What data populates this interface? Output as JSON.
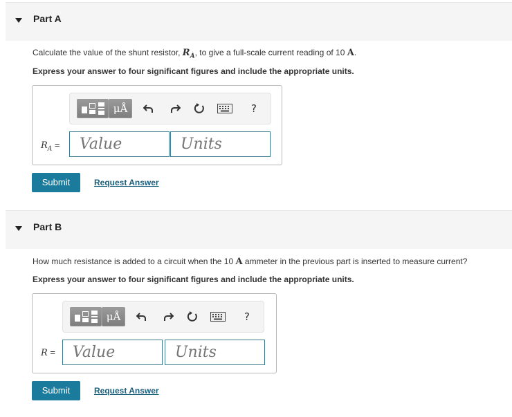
{
  "partA": {
    "title": "Part A",
    "question_pre": "Calculate the value of the shunt resistor, ",
    "question_var": "R",
    "question_var_sub": "A",
    "question_mid": ", to give a full-scale current reading of 10 ",
    "question_unit": "A",
    "question_end": ".",
    "instruction": "Express your answer to four significant figures and include the appropriate units.",
    "var_label": "R",
    "var_sub": "A",
    "eq": " =",
    "value_placeholder": "Value",
    "units_placeholder": "Units",
    "submit_label": "Submit",
    "request_label": "Request Answer"
  },
  "partB": {
    "title": "Part B",
    "question_pre": "How much resistance is added to a circuit when the 10 ",
    "question_unit": "A",
    "question_end": " ammeter in the previous part is inserted to measure current?",
    "instruction": "Express your answer to four significant figures and include the appropriate units.",
    "var_label": "R",
    "eq": " =",
    "value_placeholder": "Value",
    "units_placeholder": "Units",
    "submit_label": "Submit",
    "request_label": "Request Answer"
  },
  "toolbar": {
    "units_label": "μÅ",
    "help_label": "?",
    "icons": [
      "templates-icon",
      "units-icon",
      "undo-icon",
      "redo-icon",
      "reset-icon",
      "keyboard-icon",
      "help-icon"
    ]
  },
  "colors": {
    "submit": "#1b7b9c",
    "link": "#1b5f7d",
    "field_border": "#3a7a8c",
    "header_bg": "#f5f5f5"
  }
}
